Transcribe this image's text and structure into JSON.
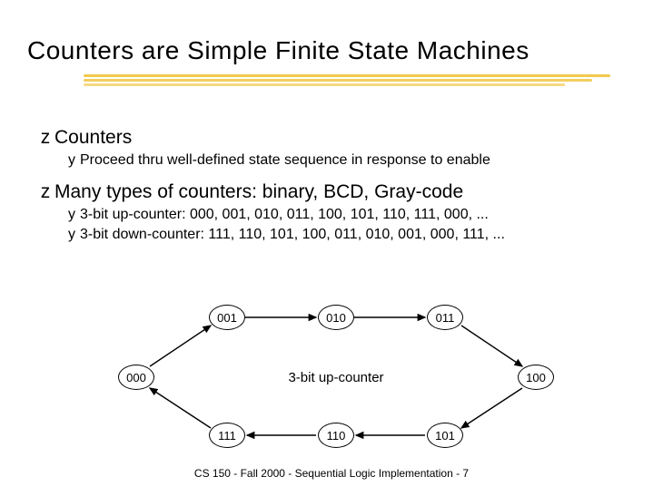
{
  "title": "Counters are Simple Finite State Machines",
  "bullets": {
    "l1a": "Counters",
    "l2a": "Proceed thru well-defined state sequence in response to enable",
    "l1b": "Many types of counters: binary, BCD, Gray-code",
    "l2b": "3-bit up-counter: 000, 001, 010, 011, 100, 101, 110, 111, 000, ...",
    "l2c": "3-bit down-counter:  111, 110, 101, 100, 011, 010, 001, 000, 111, ..."
  },
  "glyphs": {
    "z": "z",
    "y": "y"
  },
  "diagram": {
    "caption": "3-bit up-counter",
    "nodes": {
      "n000": "000",
      "n001": "001",
      "n010": "010",
      "n011": "011",
      "n100": "100",
      "n101": "101",
      "n110": "110",
      "n111": "111"
    }
  },
  "footer": "CS 150 - Fall 2000 - Sequential Logic Implementation - 7"
}
